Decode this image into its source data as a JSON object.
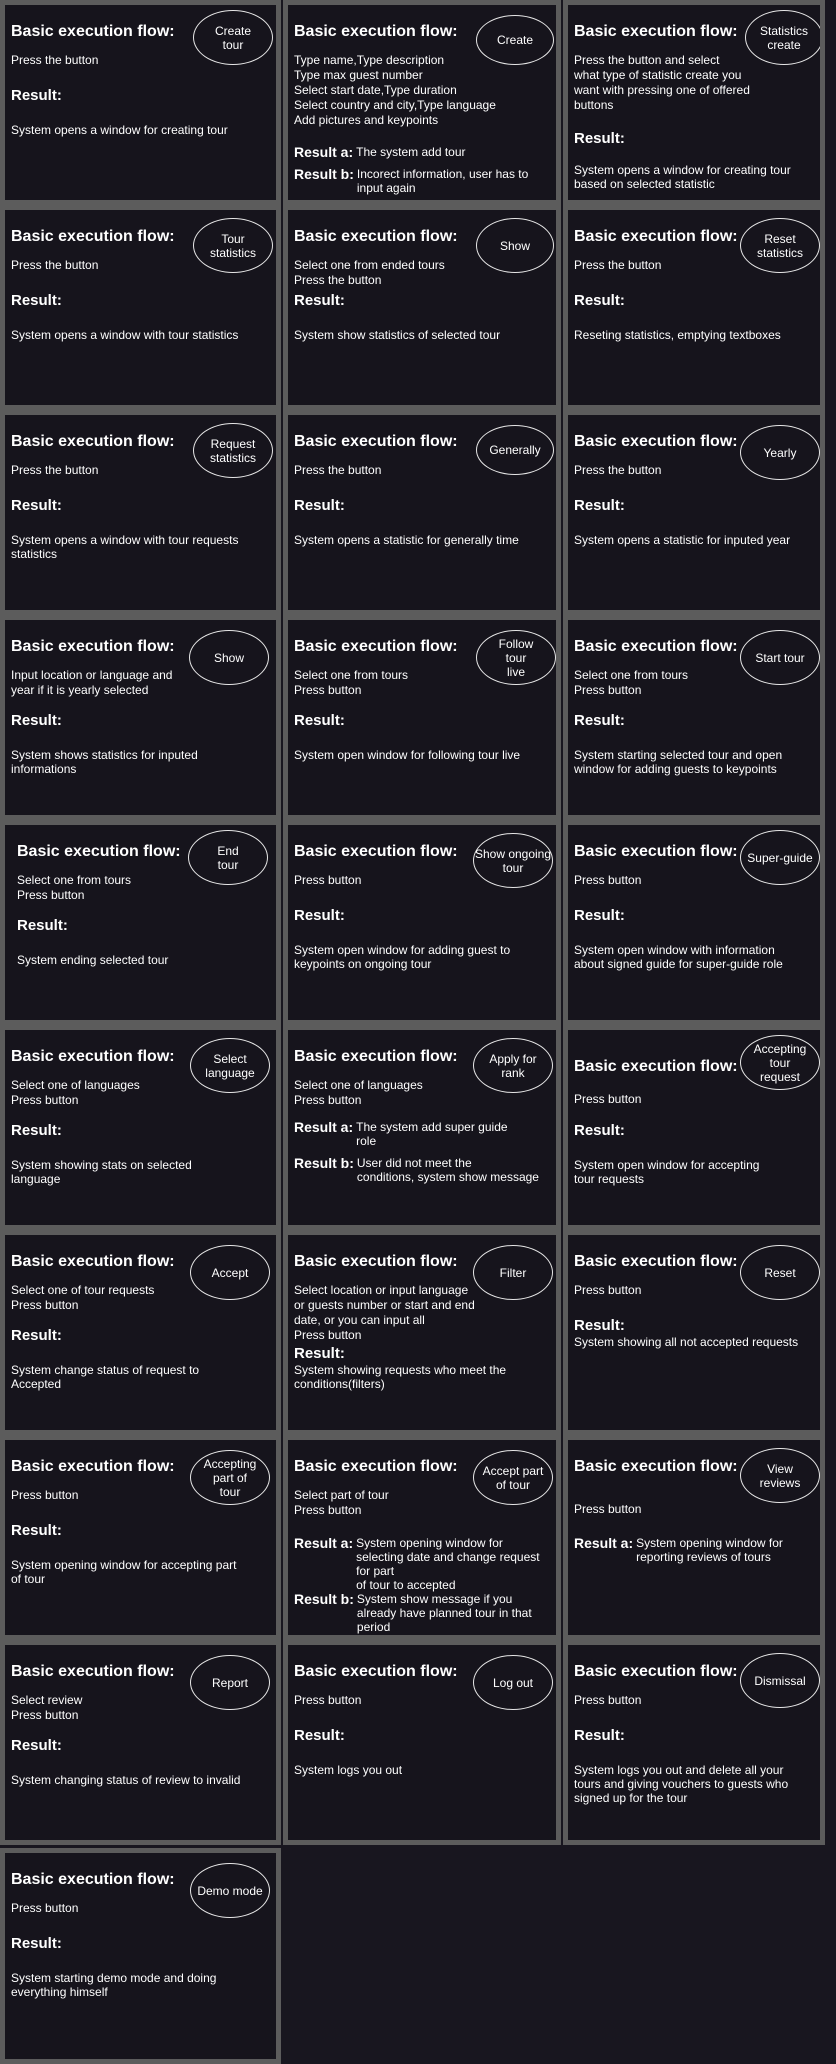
{
  "cards": [
    {
      "flow_title": "Basic execution flow:",
      "flow_text": "Press the button",
      "result_title": "Result:",
      "result_text": "System opens a window for creating tour",
      "button": "Create\ntour"
    },
    {
      "flow_title": "Basic execution flow:",
      "flow_text": "Type name,Type description\nType max guest number\nSelect start date,Type duration\nSelect country and city,Type language\nAdd pictures and keypoints",
      "results": [
        {
          "label": "Result a:",
          "text": "The system add tour"
        },
        {
          "label": "Result b:",
          "text": "Incorect information, user has to\ninput again"
        }
      ],
      "button": "Create"
    },
    {
      "flow_title": "Basic execution flow:",
      "flow_text": "Press the button and select\nwhat type of statistic create you\nwant with pressing one of offered\nbuttons",
      "result_title": "Result:",
      "result_text": "System opens a window for creating tour\nbased on selected statistic",
      "button": "Statistics\ncreate"
    },
    {
      "flow_title": "Basic execution flow:",
      "flow_text": "Press the button",
      "result_title": "Result:",
      "result_text": "System opens a window with tour statistics",
      "button": "Tour\nstatistics"
    },
    {
      "flow_title": "Basic execution flow:",
      "flow_text": "Select one from ended tours\nPress the button",
      "result_title": "Result:",
      "result_text": "System show statistics of selected tour",
      "button": "Show"
    },
    {
      "flow_title": "Basic execution flow:",
      "flow_text": "Press the button",
      "result_title": "Result:",
      "result_text": "Reseting statistics, emptying textboxes",
      "button": "Reset\nstatistics"
    },
    {
      "flow_title": "Basic execution flow:",
      "flow_text": "Press the button",
      "result_title": "Result:",
      "result_text": "System opens a window with tour requests\nstatistics",
      "button": "Request\nstatistics"
    },
    {
      "flow_title": "Basic execution flow:",
      "flow_text": "Press the button",
      "result_title": "Result:",
      "result_text": "System opens a statistic for generally time",
      "button": "Generally"
    },
    {
      "flow_title": "Basic execution flow:",
      "flow_text": "Press the button",
      "result_title": "Result:",
      "result_text": "System opens a statistic for inputed year",
      "button": "Yearly"
    },
    {
      "flow_title": "Basic execution flow:",
      "flow_text": "Input location or language and\nyear if it is yearly selected",
      "result_title": "Result:",
      "result_text": "System shows statistics for inputed\ninformations",
      "button": "Show"
    },
    {
      "flow_title": "Basic execution flow:",
      "flow_text": "Select one from tours\nPress button",
      "result_title": "Result:",
      "result_text": "System open window for following tour live",
      "button": "Follow\ntour\nlive"
    },
    {
      "flow_title": "Basic execution flow:",
      "flow_text": "Select one from tours\nPress button",
      "result_title": "Result:",
      "result_text": "System starting selected tour and open\nwindow for adding guests to keypoints",
      "button": "Start tour"
    },
    {
      "flow_title": "Basic execution flow:",
      "flow_text": "Select one from tours\nPress button",
      "result_title": "Result:",
      "result_text": "System ending selected tour",
      "button": "End\ntour"
    },
    {
      "flow_title": "Basic execution flow:",
      "flow_text": "Press button",
      "result_title": "Result:",
      "result_text": "System open window for adding guest to\nkeypoints on ongoing tour",
      "button": "Show ongoing\ntour"
    },
    {
      "flow_title": "Basic execution flow:",
      "flow_text": "Press button",
      "result_title": "Result:",
      "result_text": "System open window with information\nabout signed guide for super-guide role",
      "button": "Super-guide"
    },
    {
      "flow_title": "Basic execution flow:",
      "flow_text": "Select one of languages\nPress button",
      "result_title": "Result:",
      "result_text": "System showing stats on selected\nlanguage",
      "button": "Select\nlanguage"
    },
    {
      "flow_title": "Basic execution flow:",
      "flow_text": "Select one of languages\nPress button",
      "results": [
        {
          "label": "Result a:",
          "text": "The system add super guide\nrole"
        },
        {
          "label": "Result b:",
          "text": "User did not meet the\nconditions, system show message"
        }
      ],
      "button": "Apply for\nrank"
    },
    {
      "flow_title": "Basic execution flow:",
      "flow_text": "Press button",
      "result_title": "Result:",
      "result_text": "System open window for accepting\ntour requests",
      "button": "Accepting\ntour\nrequest"
    },
    {
      "flow_title": "Basic execution flow:",
      "flow_text": "Select one of tour requests\nPress button",
      "result_title": "Result:",
      "result_text": "System change status of request to\nAccepted",
      "button": "Accept"
    },
    {
      "flow_title": "Basic execution flow:",
      "flow_text": "Select location or input language\nor guests number or start and end\ndate, or you can input all\nPress button",
      "result_title": "Result:",
      "result_text": "System showing requests who meet the\nconditions(filters)",
      "button": "Filter"
    },
    {
      "flow_title": "Basic execution flow:",
      "flow_text": "Press button",
      "result_title": "Result:",
      "result_text": "System showing all not accepted requests",
      "button": "Reset"
    },
    {
      "flow_title": "Basic execution flow:",
      "flow_text": "Press button",
      "result_title": "Result:",
      "result_text": "System opening window for accepting part\nof tour",
      "button": "Accepting\npart of\ntour"
    },
    {
      "flow_title": "Basic execution flow:",
      "flow_text": "Select part of tour\nPress button",
      "results": [
        {
          "label": "Result a:",
          "text": "System opening window for\nselecting date and change request for part\nof tour to accepted"
        },
        {
          "label": "Result b:",
          "text": "System show message if you\nalready have planned tour in that period"
        }
      ],
      "button": "Accept part\nof tour"
    },
    {
      "flow_title": "Basic execution flow:",
      "flow_text": "Press button",
      "results": [
        {
          "label": "Result a:",
          "text": "System opening window for\nreporting reviews of tours"
        }
      ],
      "button": "View\nreviews"
    },
    {
      "flow_title": "Basic execution flow:",
      "flow_text": "Select review\nPress button",
      "result_title": "Result:",
      "result_text": "System changing status of review to invalid",
      "button": "Report"
    },
    {
      "flow_title": "Basic execution flow:",
      "flow_text": "Press button",
      "result_title": "Result:",
      "result_text": "System logs you out",
      "button": "Log out"
    },
    {
      "flow_title": "Basic execution flow:",
      "flow_text": "Press button",
      "result_title": "Result:",
      "result_text": "System logs you out and delete all your\ntours and giving vouchers to guests who\nsigned up for the tour",
      "button": "Dismissal"
    },
    {
      "flow_title": "Basic execution flow:",
      "flow_text": "Press button",
      "result_title": "Result:",
      "result_text": "System starting demo mode and doing\neverything himself",
      "button": "Demo mode"
    }
  ]
}
